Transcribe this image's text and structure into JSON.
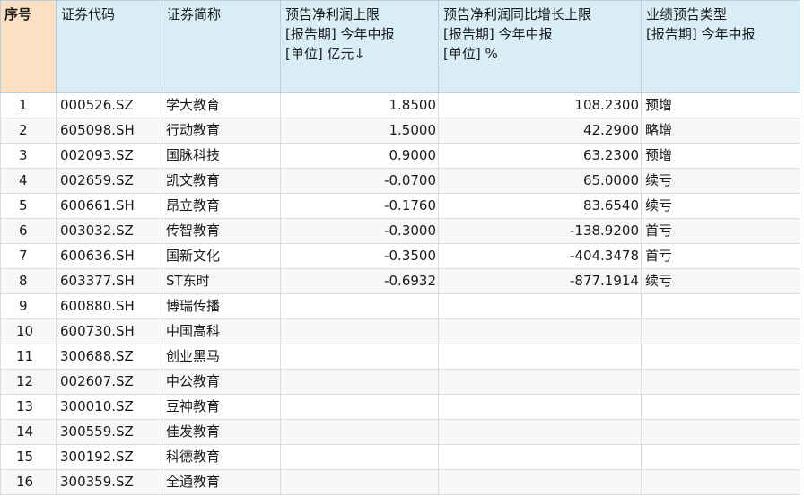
{
  "headers": [
    {
      "lines": [
        "序号"
      ]
    },
    {
      "lines": [
        "证券代码"
      ]
    },
    {
      "lines": [
        "证券简称"
      ]
    },
    {
      "lines": [
        "预告净利润上限",
        "[报告期] 今年中报",
        "[单位] 亿元↓"
      ]
    },
    {
      "lines": [
        "预告净利润同比增长上限",
        "[报告期] 今年中报",
        "[单位] %"
      ]
    },
    {
      "lines": [
        "业绩预告类型",
        "[报告期] 今年中报"
      ]
    }
  ],
  "rows": [
    {
      "idx": "1",
      "code": "000526.SZ",
      "name": "学大教育",
      "profit": "1.8500",
      "growth": "108.2300",
      "type": "预增"
    },
    {
      "idx": "2",
      "code": "605098.SH",
      "name": "行动教育",
      "profit": "1.5000",
      "growth": "42.2900",
      "type": "略增"
    },
    {
      "idx": "3",
      "code": "002093.SZ",
      "name": "国脉科技",
      "profit": "0.9000",
      "growth": "63.2300",
      "type": "预增"
    },
    {
      "idx": "4",
      "code": "002659.SZ",
      "name": "凯文教育",
      "profit": "-0.0700",
      "growth": "65.0000",
      "type": "续亏"
    },
    {
      "idx": "5",
      "code": "600661.SH",
      "name": "昂立教育",
      "profit": "-0.1760",
      "growth": "83.6540",
      "type": "续亏"
    },
    {
      "idx": "6",
      "code": "003032.SZ",
      "name": "传智教育",
      "profit": "-0.3000",
      "growth": "-138.9200",
      "type": "首亏"
    },
    {
      "idx": "7",
      "code": "600636.SH",
      "name": "国新文化",
      "profit": "-0.3500",
      "growth": "-404.3478",
      "type": "首亏"
    },
    {
      "idx": "8",
      "code": "603377.SH",
      "name": "ST东时",
      "profit": "-0.6932",
      "growth": "-877.1914",
      "type": "续亏"
    },
    {
      "idx": "9",
      "code": "600880.SH",
      "name": "博瑞传播",
      "profit": "",
      "growth": "",
      "type": ""
    },
    {
      "idx": "10",
      "code": "600730.SH",
      "name": "中国高科",
      "profit": "",
      "growth": "",
      "type": ""
    },
    {
      "idx": "11",
      "code": "300688.SZ",
      "name": "创业黑马",
      "profit": "",
      "growth": "",
      "type": ""
    },
    {
      "idx": "12",
      "code": "002607.SZ",
      "name": "中公教育",
      "profit": "",
      "growth": "",
      "type": ""
    },
    {
      "idx": "13",
      "code": "300010.SZ",
      "name": "豆神教育",
      "profit": "",
      "growth": "",
      "type": ""
    },
    {
      "idx": "14",
      "code": "300559.SZ",
      "name": "佳发教育",
      "profit": "",
      "growth": "",
      "type": ""
    },
    {
      "idx": "15",
      "code": "300192.SZ",
      "name": "科德教育",
      "profit": "",
      "growth": "",
      "type": ""
    },
    {
      "idx": "16",
      "code": "300359.SZ",
      "name": "全通教育",
      "profit": "",
      "growth": "",
      "type": ""
    }
  ]
}
